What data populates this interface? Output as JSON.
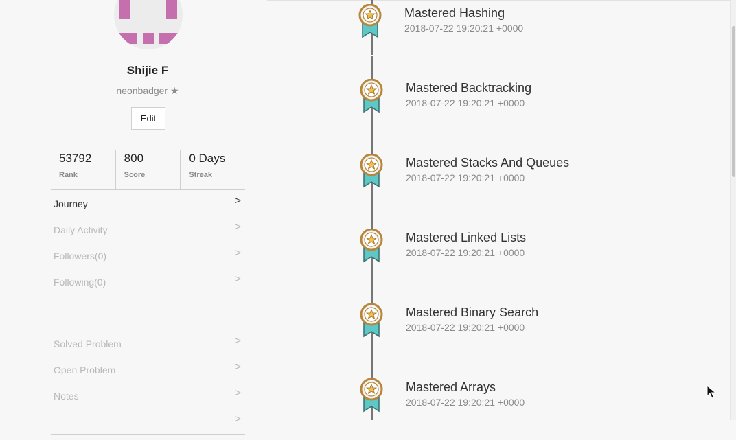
{
  "profile": {
    "name": "Shijie F",
    "username": "neonbadger",
    "edit_label": "Edit"
  },
  "stats": [
    {
      "value": "53792",
      "label": "Rank"
    },
    {
      "value": "800",
      "label": "Score"
    },
    {
      "value": "0 Days",
      "label": "Streak"
    }
  ],
  "menu_primary": [
    {
      "label": "Journey",
      "active": true
    },
    {
      "label": "Daily Activity",
      "active": false
    },
    {
      "label": "Followers(0)",
      "active": false
    },
    {
      "label": "Following(0)",
      "active": false
    }
  ],
  "menu_secondary": [
    {
      "label": "Solved Problem"
    },
    {
      "label": "Open Problem"
    },
    {
      "label": "Notes"
    }
  ],
  "timeline": [
    {
      "title": "Mastered Hashing",
      "time": "2018-07-22 19:20:21 +0000"
    },
    {
      "title": "Mastered Backtracking",
      "time": "2018-07-22 19:20:21 +0000"
    },
    {
      "title": "Mastered Stacks And Queues",
      "time": "2018-07-22 19:20:21 +0000"
    },
    {
      "title": "Mastered Linked Lists",
      "time": "2018-07-22 19:20:21 +0000"
    },
    {
      "title": "Mastered Binary Search",
      "time": "2018-07-22 19:20:21 +0000"
    },
    {
      "title": "Mastered Arrays",
      "time": "2018-07-22 19:20:21 +0000"
    }
  ],
  "colors": {
    "avatar_accent": "#c56fae",
    "badge_gold": "#b8863b",
    "badge_ribbon": "#5ec8c7"
  },
  "icons": {
    "verified": "star-icon",
    "menu_chevron": "chevron-right-icon",
    "achievement": "medal-badge-icon"
  }
}
